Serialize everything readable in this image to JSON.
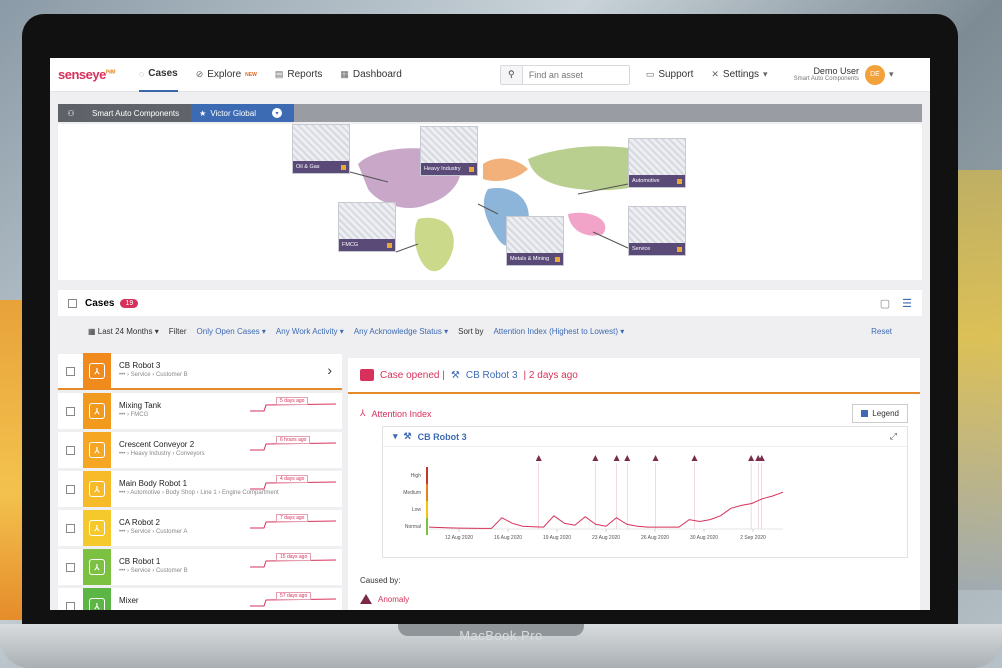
{
  "device": {
    "brand": "MacBook Pro"
  },
  "app": {
    "logo": "senseye",
    "logo_sup": "PdM",
    "nav": [
      {
        "label": "Cases",
        "icon": "cases-icon",
        "active": true
      },
      {
        "label": "Explore",
        "badge": "NEW",
        "icon": "explore-icon"
      },
      {
        "label": "Reports",
        "icon": "reports-icon"
      },
      {
        "label": "Dashboard",
        "icon": "dashboard-icon"
      }
    ],
    "search_placeholder": "Find an asset",
    "support_label": "Support",
    "settings_label": "Settings",
    "user": {
      "name": "Demo User",
      "org": "Smart Auto Components",
      "initials": "DE"
    }
  },
  "breadcrumb": {
    "level1": "Smart Auto Components",
    "level2": "Victor Global"
  },
  "map_tiles": [
    {
      "label": "Oil & Gas"
    },
    {
      "label": "Heavy Industry"
    },
    {
      "label": "Automotive"
    },
    {
      "label": "FMCG"
    },
    {
      "label": "Metals & Mining"
    },
    {
      "label": "Service"
    }
  ],
  "cases": {
    "title": "Cases",
    "count": "19",
    "filters": {
      "period": "Last 24 Months",
      "filter_label": "Filter",
      "filter_value": "Only Open Cases",
      "activity": "Any Work Activity",
      "ack": "Any Acknowledge Status",
      "sort_label": "Sort by",
      "sort_value": "Attention Index (Highest to Lowest)",
      "reset": "Reset"
    },
    "items": [
      {
        "name": "CB Robot 3",
        "path": "••• › Service › Customer B",
        "ago": "",
        "color": "#f08a1c"
      },
      {
        "name": "Mixing Tank",
        "path": "••• › FMCG",
        "ago": "5 days ago",
        "color": "#f29a1e"
      },
      {
        "name": "Crescent Conveyor 2",
        "path": "••• › Heavy Industry › Conveyors",
        "ago": "6 hours ago",
        "color": "#f5a623"
      },
      {
        "name": "Main Body Robot 1",
        "path": "••• › Automotive › Body Shop › Line 1 › Engine Compartment",
        "ago": "4 days ago",
        "color": "#f7bb2a"
      },
      {
        "name": "CA Robot 2",
        "path": "••• › Service › Customer A",
        "ago": "7 days ago",
        "color": "#f5c82c"
      },
      {
        "name": "CB Robot 1",
        "path": "••• › Service › Customer B",
        "ago": "15 days ago",
        "color": "#7cc142"
      },
      {
        "name": "Mixer",
        "path": "",
        "ago": "57 days ago",
        "color": "#5cb646"
      }
    ]
  },
  "detail": {
    "case_opened": "Case opened |",
    "asset": "CB Robot 3",
    "ago": "| 2 days ago",
    "section": "Attention Index",
    "legend": "Legend",
    "chart_title": "CB Robot 3",
    "caused_by": "Caused by:",
    "cause": "Anomaly"
  },
  "chart_data": {
    "type": "line",
    "ylabel_levels": [
      "High",
      "Medium",
      "Low",
      "Normal"
    ],
    "x_ticks": [
      "12 Aug 2020",
      "19 Aug 2020",
      "26 Aug 2020",
      "2 Sep 2020"
    ],
    "x_ticks_minor": [
      "16 Aug 2020",
      "23 Aug 2020",
      "30 Aug 2020"
    ],
    "x_ticks_all": [
      "12 Aug 2020",
      "16 Aug 2020",
      "19 Aug 2020",
      "23 Aug 2020",
      "26 Aug 2020",
      "30 Aug 2020",
      "2 Sep 2020"
    ],
    "series": [
      {
        "values": [
          0.1,
          0.08,
          0.06,
          0.05,
          0.04,
          0.03,
          0.03,
          0.6,
          0.3,
          0.15,
          0.12,
          0.1,
          0.7,
          0.3,
          0.2,
          0.65,
          0.25,
          0.15,
          0.6,
          0.25,
          0.15,
          0.1,
          0.1,
          0.1,
          0.1,
          0.5,
          0.4,
          0.5,
          0.7,
          1.1,
          1.25,
          1.35,
          1.6,
          1.75,
          1.95
        ]
      }
    ],
    "y_range": [
      0,
      3.5
    ],
    "alert_positions": [
      0.31,
      0.47,
      0.53,
      0.56,
      0.64,
      0.75,
      0.91,
      0.93,
      0.94
    ],
    "accent": "#d6315b"
  }
}
